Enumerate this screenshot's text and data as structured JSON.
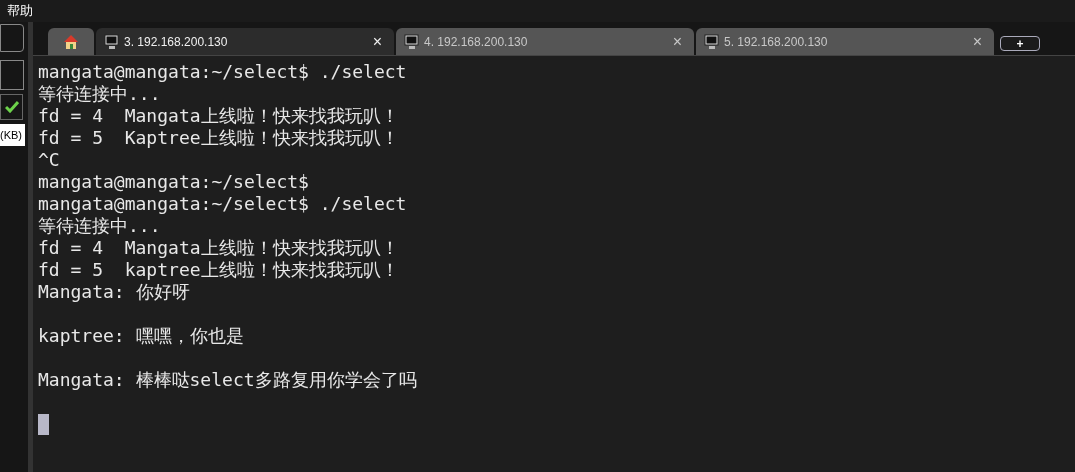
{
  "menu_bar": {
    "items": [
      "帮助"
    ]
  },
  "left_panel": {
    "size_label": "(KB)",
    "status_checked": true
  },
  "tabs": [
    {
      "kind": "home",
      "selected": false
    },
    {
      "kind": "session",
      "label": "3. 192.168.200.130",
      "close": "×",
      "selected": true
    },
    {
      "kind": "session",
      "label": "4. 192.168.200.130",
      "close": "×",
      "selected": false
    },
    {
      "kind": "session",
      "label": "5. 192.168.200.130",
      "close": "×",
      "selected": false
    },
    {
      "kind": "new",
      "label": "+",
      "selected": false
    }
  ],
  "terminal": {
    "lines": [
      {
        "kind": "text",
        "text": "mangata@mangata:~/select$ ./select"
      },
      {
        "kind": "text",
        "text": "等待连接中..."
      },
      {
        "kind": "text",
        "text": "fd = 4  Mangata上线啦！快来找我玩叭！"
      },
      {
        "kind": "text",
        "text": "fd = 5  Kaptree上线啦！快来找我玩叭！"
      },
      {
        "kind": "text",
        "text": "^C"
      },
      {
        "kind": "text",
        "text": "mangata@mangata:~/select$"
      },
      {
        "kind": "text",
        "text": "mangata@mangata:~/select$ ./select"
      },
      {
        "kind": "text",
        "text": "等待连接中..."
      },
      {
        "kind": "text",
        "text": "fd = 4  Mangata上线啦！快来找我玩叭！"
      },
      {
        "kind": "text",
        "text": "fd = 5  kaptree上线啦！快来找我玩叭！"
      },
      {
        "kind": "text",
        "text": "Mangata: 你好呀"
      },
      {
        "kind": "blank"
      },
      {
        "kind": "text",
        "text": "kaptree: 嘿嘿，你也是"
      },
      {
        "kind": "blank"
      },
      {
        "kind": "text",
        "text": "Mangata: 棒棒哒select多路复用你学会了吗"
      },
      {
        "kind": "blank"
      },
      {
        "kind": "cursor"
      }
    ]
  }
}
